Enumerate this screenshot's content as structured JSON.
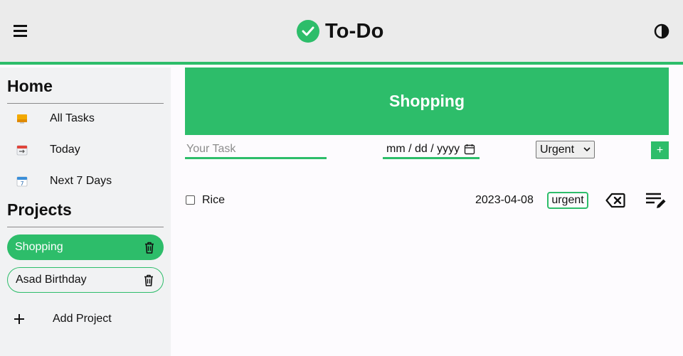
{
  "header": {
    "title": "To-Do",
    "menu_icon": "hamburger-menu-icon",
    "logo_icon": "check-circle-icon",
    "theme_icon": "contrast-toggle-icon",
    "accent_color": "#2dbd6a"
  },
  "sidebar": {
    "home_title": "Home",
    "home_items": [
      {
        "label": "All Tasks",
        "icon": "inbox-icon"
      },
      {
        "label": "Today",
        "icon": "calendar-today-icon"
      },
      {
        "label": "Next 7 Days",
        "icon": "calendar-week-icon"
      }
    ],
    "projects_title": "Projects",
    "projects": [
      {
        "label": "Shopping",
        "active": true
      },
      {
        "label": "Asad Birthday",
        "active": false
      }
    ],
    "add_project_label": "Add Project"
  },
  "main": {
    "project_title": "Shopping",
    "form": {
      "task_placeholder": "Your Task",
      "task_value": "",
      "date_placeholder": "mm / dd / yyyy",
      "priority_value": "Urgent",
      "add_label": "+"
    },
    "tasks": [
      {
        "name": "Rice",
        "date": "2023-04-08",
        "priority": "urgent",
        "done": false
      }
    ]
  }
}
